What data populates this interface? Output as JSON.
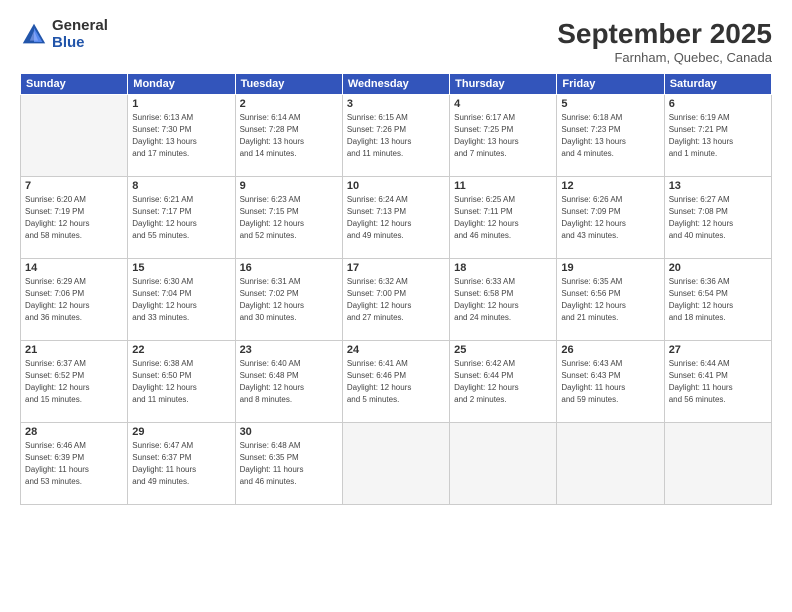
{
  "logo": {
    "general": "General",
    "blue": "Blue"
  },
  "title": "September 2025",
  "location": "Farnham, Quebec, Canada",
  "days_of_week": [
    "Sunday",
    "Monday",
    "Tuesday",
    "Wednesday",
    "Thursday",
    "Friday",
    "Saturday"
  ],
  "weeks": [
    [
      {
        "day": "",
        "info": ""
      },
      {
        "day": "1",
        "info": "Sunrise: 6:13 AM\nSunset: 7:30 PM\nDaylight: 13 hours\nand 17 minutes."
      },
      {
        "day": "2",
        "info": "Sunrise: 6:14 AM\nSunset: 7:28 PM\nDaylight: 13 hours\nand 14 minutes."
      },
      {
        "day": "3",
        "info": "Sunrise: 6:15 AM\nSunset: 7:26 PM\nDaylight: 13 hours\nand 11 minutes."
      },
      {
        "day": "4",
        "info": "Sunrise: 6:17 AM\nSunset: 7:25 PM\nDaylight: 13 hours\nand 7 minutes."
      },
      {
        "day": "5",
        "info": "Sunrise: 6:18 AM\nSunset: 7:23 PM\nDaylight: 13 hours\nand 4 minutes."
      },
      {
        "day": "6",
        "info": "Sunrise: 6:19 AM\nSunset: 7:21 PM\nDaylight: 13 hours\nand 1 minute."
      }
    ],
    [
      {
        "day": "7",
        "info": "Sunrise: 6:20 AM\nSunset: 7:19 PM\nDaylight: 12 hours\nand 58 minutes."
      },
      {
        "day": "8",
        "info": "Sunrise: 6:21 AM\nSunset: 7:17 PM\nDaylight: 12 hours\nand 55 minutes."
      },
      {
        "day": "9",
        "info": "Sunrise: 6:23 AM\nSunset: 7:15 PM\nDaylight: 12 hours\nand 52 minutes."
      },
      {
        "day": "10",
        "info": "Sunrise: 6:24 AM\nSunset: 7:13 PM\nDaylight: 12 hours\nand 49 minutes."
      },
      {
        "day": "11",
        "info": "Sunrise: 6:25 AM\nSunset: 7:11 PM\nDaylight: 12 hours\nand 46 minutes."
      },
      {
        "day": "12",
        "info": "Sunrise: 6:26 AM\nSunset: 7:09 PM\nDaylight: 12 hours\nand 43 minutes."
      },
      {
        "day": "13",
        "info": "Sunrise: 6:27 AM\nSunset: 7:08 PM\nDaylight: 12 hours\nand 40 minutes."
      }
    ],
    [
      {
        "day": "14",
        "info": "Sunrise: 6:29 AM\nSunset: 7:06 PM\nDaylight: 12 hours\nand 36 minutes."
      },
      {
        "day": "15",
        "info": "Sunrise: 6:30 AM\nSunset: 7:04 PM\nDaylight: 12 hours\nand 33 minutes."
      },
      {
        "day": "16",
        "info": "Sunrise: 6:31 AM\nSunset: 7:02 PM\nDaylight: 12 hours\nand 30 minutes."
      },
      {
        "day": "17",
        "info": "Sunrise: 6:32 AM\nSunset: 7:00 PM\nDaylight: 12 hours\nand 27 minutes."
      },
      {
        "day": "18",
        "info": "Sunrise: 6:33 AM\nSunset: 6:58 PM\nDaylight: 12 hours\nand 24 minutes."
      },
      {
        "day": "19",
        "info": "Sunrise: 6:35 AM\nSunset: 6:56 PM\nDaylight: 12 hours\nand 21 minutes."
      },
      {
        "day": "20",
        "info": "Sunrise: 6:36 AM\nSunset: 6:54 PM\nDaylight: 12 hours\nand 18 minutes."
      }
    ],
    [
      {
        "day": "21",
        "info": "Sunrise: 6:37 AM\nSunset: 6:52 PM\nDaylight: 12 hours\nand 15 minutes."
      },
      {
        "day": "22",
        "info": "Sunrise: 6:38 AM\nSunset: 6:50 PM\nDaylight: 12 hours\nand 11 minutes."
      },
      {
        "day": "23",
        "info": "Sunrise: 6:40 AM\nSunset: 6:48 PM\nDaylight: 12 hours\nand 8 minutes."
      },
      {
        "day": "24",
        "info": "Sunrise: 6:41 AM\nSunset: 6:46 PM\nDaylight: 12 hours\nand 5 minutes."
      },
      {
        "day": "25",
        "info": "Sunrise: 6:42 AM\nSunset: 6:44 PM\nDaylight: 12 hours\nand 2 minutes."
      },
      {
        "day": "26",
        "info": "Sunrise: 6:43 AM\nSunset: 6:43 PM\nDaylight: 11 hours\nand 59 minutes."
      },
      {
        "day": "27",
        "info": "Sunrise: 6:44 AM\nSunset: 6:41 PM\nDaylight: 11 hours\nand 56 minutes."
      }
    ],
    [
      {
        "day": "28",
        "info": "Sunrise: 6:46 AM\nSunset: 6:39 PM\nDaylight: 11 hours\nand 53 minutes."
      },
      {
        "day": "29",
        "info": "Sunrise: 6:47 AM\nSunset: 6:37 PM\nDaylight: 11 hours\nand 49 minutes."
      },
      {
        "day": "30",
        "info": "Sunrise: 6:48 AM\nSunset: 6:35 PM\nDaylight: 11 hours\nand 46 minutes."
      },
      {
        "day": "",
        "info": ""
      },
      {
        "day": "",
        "info": ""
      },
      {
        "day": "",
        "info": ""
      },
      {
        "day": "",
        "info": ""
      }
    ]
  ]
}
